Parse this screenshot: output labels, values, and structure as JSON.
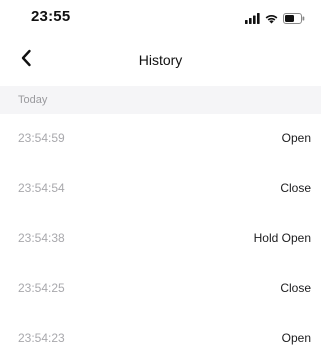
{
  "status_bar": {
    "time": "23:55",
    "icons": [
      "signal-icon",
      "wifi-icon",
      "battery-icon"
    ]
  },
  "nav": {
    "back_icon": "chevron-left-icon",
    "title": "History"
  },
  "section": {
    "label": "Today"
  },
  "rows": [
    {
      "time": "23:54:59",
      "action": "Open"
    },
    {
      "time": "23:54:54",
      "action": "Close"
    },
    {
      "time": "23:54:38",
      "action": "Hold Open"
    },
    {
      "time": "23:54:25",
      "action": "Close"
    },
    {
      "time": "23:54:23",
      "action": "Open"
    }
  ]
}
